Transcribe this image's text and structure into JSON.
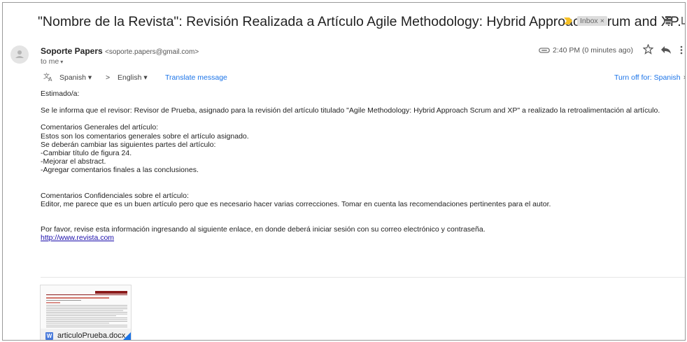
{
  "email": {
    "subject": "\"Nombre de la Revista\": Revisión Realizada a Artículo Agile Methodology: Hybrid Approach Scrum and XP.",
    "label": "Inbox",
    "label_close": "×"
  },
  "sender": {
    "name": "Soporte Papers",
    "email": "<soporte.papers@gmail.com>",
    "to": "to me",
    "caret": "▾",
    "time": "2:40 PM (0 minutes ago)"
  },
  "translate": {
    "from": "Spanish ▾",
    "arrow": ">",
    "to": "English ▾",
    "link": "Translate message",
    "turn_off": "Turn off for: Spanish",
    "close": "×"
  },
  "body": {
    "greeting": "Estimado/a:",
    "intro": "Se le informa que el revisor: Revisor de Prueba, asignado para la revisión del artículo titulado \"Agile Methodology: Hybrid Approach Scrum and XP\" a realizado la retroalimentación al artículo.",
    "general_lines": [
      "Comentarios Generales del artículo:",
      "Estos son los comentarios generales sobre el artículo asignado.",
      "Se deberán cambiar las siguientes partes del artículo:",
      "-Cambiar título de figura 24.",
      "-Mejorar el abstract.",
      "-Agregar comentarios finales a las conclusiones."
    ],
    "confidential_lines": [
      "Comentarios Confidenciales sobre el artículo:",
      "Editor, me parece que es un buen artículo pero que es necesario hacer varias correcciones. Tomar en cuenta las recomendaciones pertinentes para el autor."
    ],
    "closing": "Por favor, revise esta información ingresando al siguiente enlace, en donde deberá iniciar sesión con su correo electrónico y contraseña.",
    "link": "http://www.revista.com"
  },
  "attachment": {
    "icon_letter": "W",
    "filename": "articuloPrueba.docx"
  },
  "colors": {
    "link_blue": "#1a73e8",
    "importance": "#f6c026",
    "word_blue": "#4a7bdb",
    "doc_header": "#8b1a1a"
  }
}
